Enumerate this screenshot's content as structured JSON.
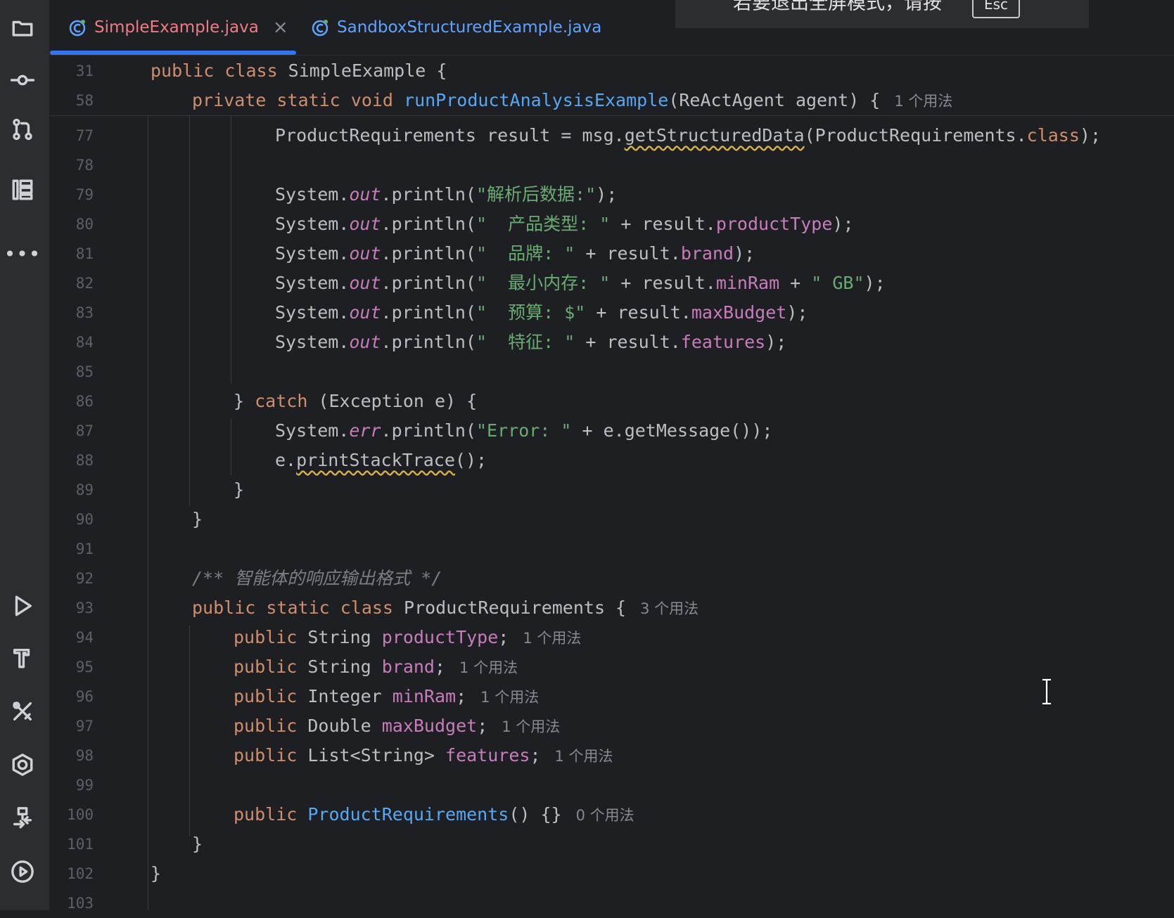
{
  "tabs": [
    {
      "label": "SimpleExample.java",
      "active": true,
      "close": "×"
    },
    {
      "label": "SandboxStructuredExample.java",
      "active": false
    }
  ],
  "notice": {
    "text": "若要退出全屏模式，请按",
    "key": "Esc"
  },
  "sidebar": {
    "icons": [
      "folder-icon",
      "commit-icon",
      "pull-request-icon",
      "structure-icon",
      "more-icon",
      "run-icon",
      "build-hammer-icon",
      "tools-icon",
      "services-icon",
      "deploy-icon",
      "debug-run-icon"
    ],
    "more_label": "•••"
  },
  "sticky_lines": [
    {
      "num": "31",
      "text": "public class SimpleExample {"
    },
    {
      "num": "58",
      "text": "private static void runProductAnalysisExample(ReActAgent agent) {",
      "hint": "1 个用法"
    }
  ],
  "lines": [
    {
      "num": "77",
      "text": "ProductRequirements result = msg.getStructuredData(ProductRequirements.class);"
    },
    {
      "num": "78",
      "text": ""
    },
    {
      "num": "79",
      "text": "System.out.println(\"解析后数据:\");"
    },
    {
      "num": "80",
      "text": "System.out.println(\"  产品类型: \" + result.productType);"
    },
    {
      "num": "81",
      "text": "System.out.println(\"  品牌: \" + result.brand);"
    },
    {
      "num": "82",
      "text": "System.out.println(\"  最小内存: \" + result.minRam + \" GB\");"
    },
    {
      "num": "83",
      "text": "System.out.println(\"  预算: $\" + result.maxBudget);"
    },
    {
      "num": "84",
      "text": "System.out.println(\"  特征: \" + result.features);"
    },
    {
      "num": "85",
      "text": ""
    },
    {
      "num": "86",
      "text": "} catch (Exception e) {"
    },
    {
      "num": "87",
      "text": "System.err.println(\"Error: \" + e.getMessage());"
    },
    {
      "num": "88",
      "text": "e.printStackTrace();"
    },
    {
      "num": "89",
      "text": "}"
    },
    {
      "num": "90",
      "text": "}"
    },
    {
      "num": "91",
      "text": ""
    },
    {
      "num": "92",
      "text": "/** 智能体的响应输出格式 */"
    },
    {
      "num": "93",
      "text": "public static class ProductRequirements {",
      "hint": "3 个用法"
    },
    {
      "num": "94",
      "text": "public String productType;",
      "hint": "1 个用法"
    },
    {
      "num": "95",
      "text": "public String brand;",
      "hint": "1 个用法"
    },
    {
      "num": "96",
      "text": "public Integer minRam;",
      "hint": "1 个用法"
    },
    {
      "num": "97",
      "text": "public Double maxBudget;",
      "hint": "1 个用法"
    },
    {
      "num": "98",
      "text": "public List<String> features;",
      "hint": "1 个用法"
    },
    {
      "num": "99",
      "text": ""
    },
    {
      "num": "100",
      "text": "public ProductRequirements() {}",
      "hint": "0 个用法"
    },
    {
      "num": "101",
      "text": "}"
    },
    {
      "num": "102",
      "text": "}"
    },
    {
      "num": "103",
      "text": ""
    }
  ],
  "colors": {
    "keyword": "#cf8e6d",
    "function": "#56a8f5",
    "string": "#6aab73",
    "field": "#c77dbb",
    "comment": "#7a7e85",
    "active_tab": "#f07b82",
    "inactive_tab": "#5fa3ff",
    "tab_underline": "#3574f0"
  }
}
